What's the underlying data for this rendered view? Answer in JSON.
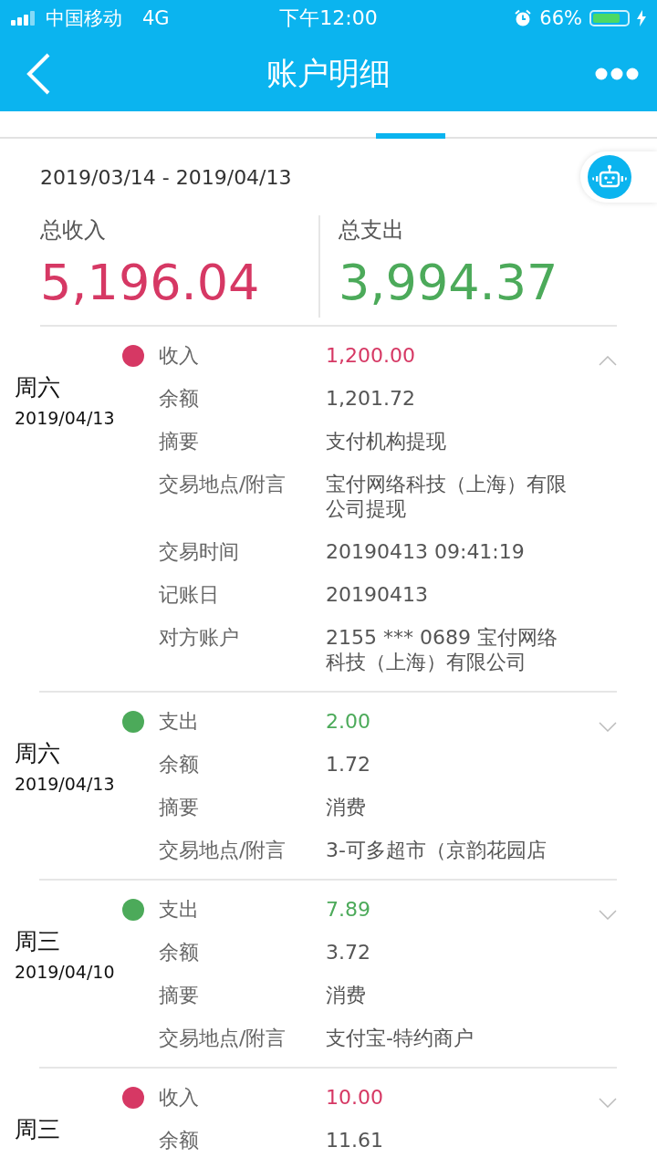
{
  "status_bar": {
    "carrier": "中国移动",
    "network": "4G",
    "time": "下午12:00",
    "battery_percent": "66%"
  },
  "nav": {
    "title": "账户明细"
  },
  "tab_indicator": true,
  "period": "2019/03/14 - 2019/04/13",
  "totals": [
    {
      "kind": "income",
      "label": "总收入",
      "amount": "5,196.04"
    },
    {
      "kind": "expense",
      "label": "总支出",
      "amount": "3,994.37"
    }
  ],
  "entries": [
    {
      "kind": "income",
      "weekday": "周六",
      "date": "2019/04/13",
      "expanded": true,
      "rows": [
        {
          "label": "收入",
          "value": "1,200.00"
        },
        {
          "label": "余额",
          "value": "1,201.72"
        },
        {
          "label": "摘要",
          "value": "支付机构提现"
        },
        {
          "label": "交易地点/附言",
          "value": "宝付网络科技（上海）有限公司提现"
        },
        {
          "label": "交易时间",
          "value": "20190413 09:41:19"
        },
        {
          "label": "记账日",
          "value": "20190413"
        },
        {
          "label": "对方账户",
          "value": "2155 *** 0689 宝付网络科技（上海）有限公司"
        }
      ]
    },
    {
      "kind": "expense",
      "weekday": "周六",
      "date": "2019/04/13",
      "expanded": false,
      "rows": [
        {
          "label": "支出",
          "value": "2.00"
        },
        {
          "label": "余额",
          "value": "1.72"
        },
        {
          "label": "摘要",
          "value": "消费"
        },
        {
          "label": "交易地点/附言",
          "value": "3-可多超市（京韵花园店"
        }
      ]
    },
    {
      "kind": "expense",
      "weekday": "周三",
      "date": "2019/04/10",
      "expanded": false,
      "rows": [
        {
          "label": "支出",
          "value": "7.89"
        },
        {
          "label": "余额",
          "value": "3.72"
        },
        {
          "label": "摘要",
          "value": "消费"
        },
        {
          "label": "交易地点/附言",
          "value": "支付宝-特约商户"
        }
      ]
    },
    {
      "kind": "income",
      "weekday": "周三",
      "expanded": false,
      "rows": [
        {
          "label": "收入",
          "value": "10.00"
        },
        {
          "label": "余额",
          "value": "11.61"
        }
      ]
    }
  ]
}
